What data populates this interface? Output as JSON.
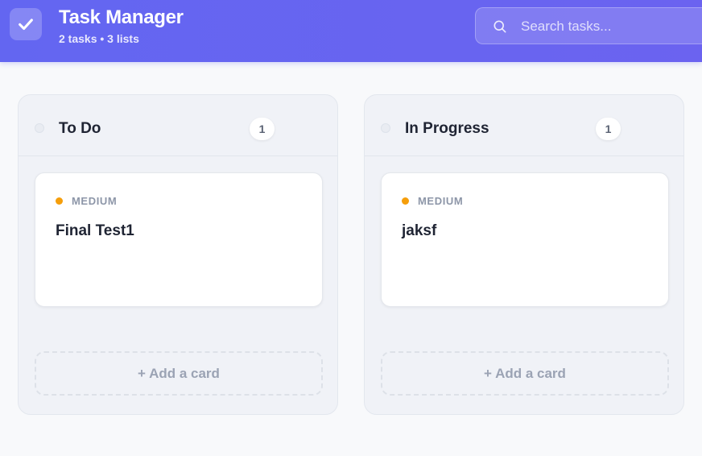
{
  "header": {
    "title": "Task Manager",
    "subtitle": "2 tasks • 3 lists",
    "logo_icon": "check-icon",
    "search": {
      "placeholder": "Search tasks...",
      "value": "",
      "icon": "search-icon"
    }
  },
  "columns": [
    {
      "title": "To Do",
      "count": "1",
      "cards": [
        {
          "priority": "MEDIUM",
          "priority_color": "#f59e0b",
          "title": "Final Test1"
        }
      ],
      "add_label": "+ Add a card"
    },
    {
      "title": "In Progress",
      "count": "1",
      "cards": [
        {
          "priority": "MEDIUM",
          "priority_color": "#f59e0b",
          "title": "jaksf"
        }
      ],
      "add_label": "+ Add a card"
    }
  ],
  "colors": {
    "header_gradient_start": "#6366f1",
    "header_gradient_end": "#6b63f0",
    "priority_medium": "#f59e0b"
  }
}
